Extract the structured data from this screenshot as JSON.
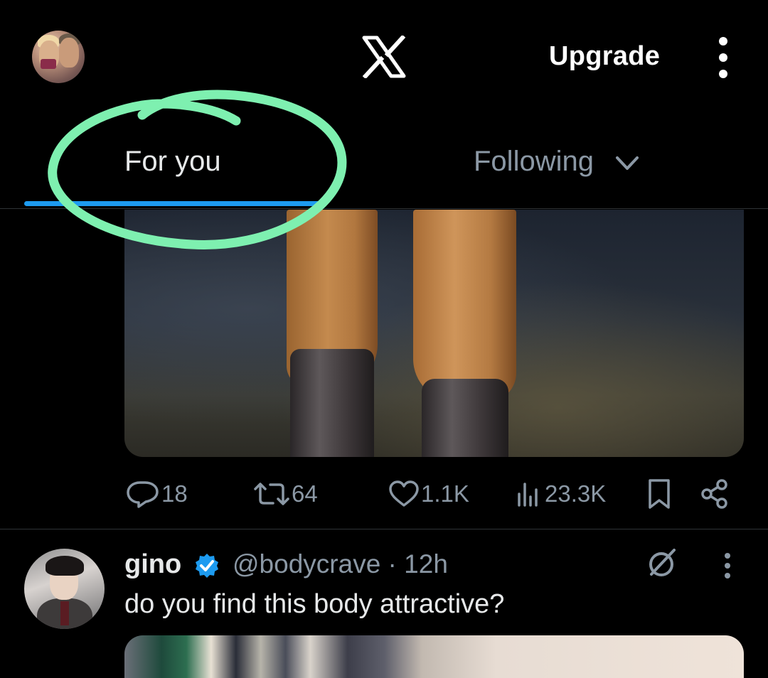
{
  "header": {
    "logo_icon": "x-logo-icon",
    "upgrade_label": "Upgrade",
    "menu_icon": "more-vertical-icon"
  },
  "tabs": [
    {
      "label": "For you",
      "active": true
    },
    {
      "label": "Following",
      "active": false,
      "icon": "chevron-down-icon"
    }
  ],
  "post1": {
    "actions": {
      "replies": "18",
      "reposts": "64",
      "likes": "1.1K",
      "views": "23.3K"
    }
  },
  "post2": {
    "name": "gino",
    "handle": "@bodycrave",
    "time": "12h",
    "text": "do you find this body attractive?"
  },
  "colors": {
    "accent": "#1d9bf0",
    "annotation": "#7ef0b0",
    "muted": "#8b98a5",
    "background": "#000000"
  }
}
